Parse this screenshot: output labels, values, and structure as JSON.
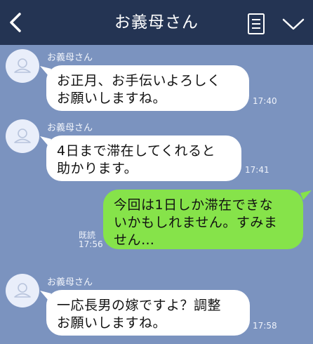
{
  "header": {
    "title": "お義母さん",
    "back_icon": "chevron-left-icon",
    "menu_icon": "list-icon",
    "collapse_icon": "chevron-down-icon"
  },
  "messages": [
    {
      "sender": "お義母さん",
      "text": "お正月、お手伝いよろしく\nお願いしますね。",
      "time": "17:40",
      "direction": "incoming"
    },
    {
      "sender": "お義母さん",
      "text": "4日まで滞在してくれると\n助かります。",
      "time": "17:41",
      "direction": "incoming"
    },
    {
      "text": "今回は1日しか滞在できな\nいかもしれません。すみま\nせん…",
      "time": "17:56",
      "status": "既読",
      "direction": "outgoing"
    },
    {
      "sender": "お義母さん",
      "text": "一応長男の嫁ですよ？調整\nお願いしますね。",
      "time": "17:58",
      "direction": "incoming"
    }
  ],
  "colors": {
    "header_bg": "#243453",
    "chat_bg": "#7b93bf",
    "incoming_bubble": "#ffffff",
    "outgoing_bubble": "#86e34a"
  }
}
